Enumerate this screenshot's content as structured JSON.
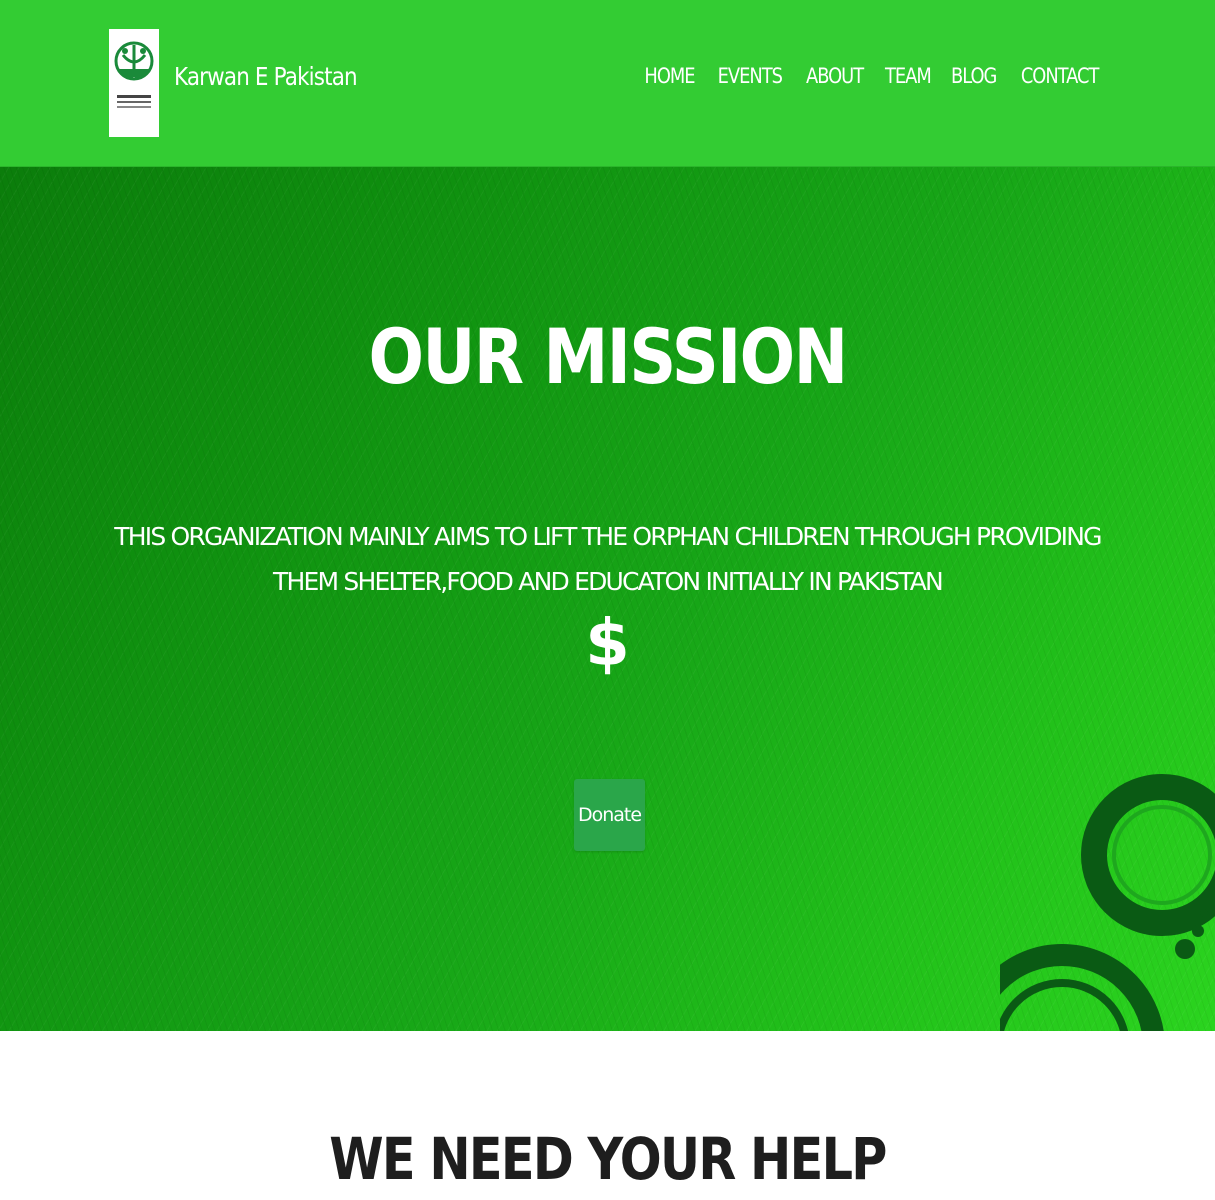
{
  "navbar": {
    "brand_name": "Karwan E Pakistan",
    "links": [
      {
        "label": "HOME"
      },
      {
        "label": "EVENTS"
      },
      {
        "label": "ABOUT"
      },
      {
        "label": "TEAM"
      },
      {
        "label": "BLOG"
      },
      {
        "label": "CONTACT"
      }
    ]
  },
  "hero": {
    "title": "OUR MISSION",
    "text": "THIS ORGANIZATION MAINLY AIMS TO LIFT THE ORPHAN CHILDREN THROUGH PROVIDING THEM SHELTER,FOOD AND EDUCATON INITIALLY IN PAKISTAN",
    "symbol": "$",
    "donate_label": "Donate"
  },
  "help": {
    "title": "WE NEED YOUR HELP"
  },
  "colors": {
    "navbar": "#33cc33",
    "hero_dark": "#0b7d0b",
    "hero_light": "#2bd41f",
    "donate_button": "#2aa64a",
    "heading_dark": "#1e1e1e"
  }
}
